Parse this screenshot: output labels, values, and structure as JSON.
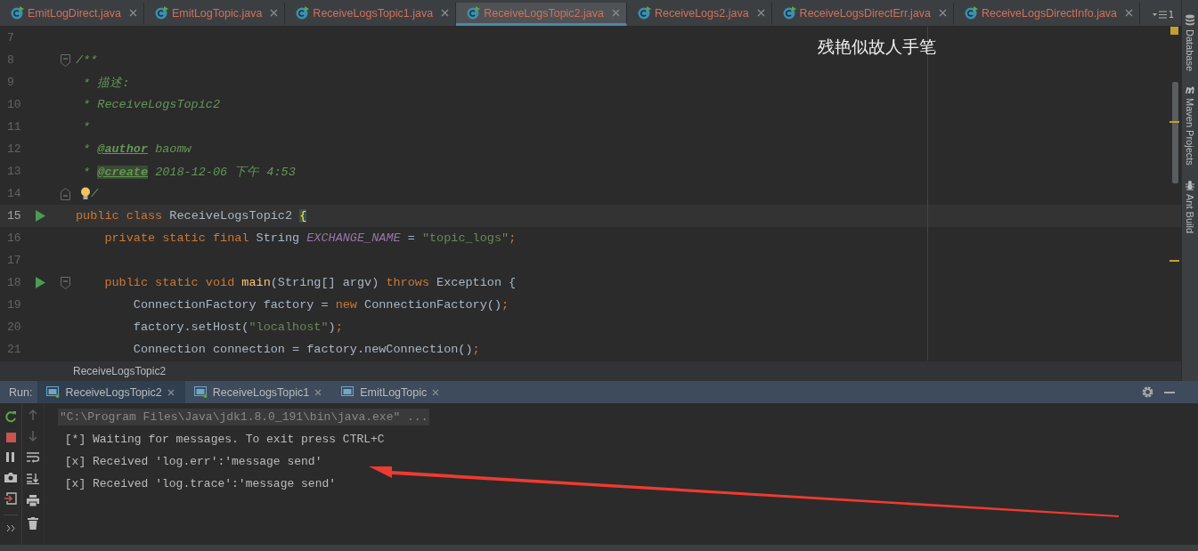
{
  "editor_tabs": [
    {
      "label": "EmitLogDirect.java",
      "selected": false
    },
    {
      "label": "EmitLogTopic.java",
      "selected": false
    },
    {
      "label": "ReceiveLogsTopic1.java",
      "selected": false
    },
    {
      "label": "ReceiveLogsTopic2.java",
      "selected": true
    },
    {
      "label": "ReceiveLogs2.java",
      "selected": false
    },
    {
      "label": "ReceiveLogsDirectErr.java",
      "selected": false
    },
    {
      "label": "ReceiveLogsDirectInfo.java",
      "selected": false
    }
  ],
  "tab_overflow_count": "1",
  "code_lines": [
    {
      "number": "7",
      "kind": "code",
      "run": false,
      "current": false
    },
    {
      "number": "8",
      "kind": "fold-start",
      "run": false,
      "current": false,
      "tokens": [
        {
          "kind": "comment",
          "text": "/**"
        }
      ]
    },
    {
      "number": "9",
      "run": false,
      "current": false,
      "tokens": [
        {
          "kind": "comment",
          "text": " * 描述:"
        }
      ]
    },
    {
      "number": "10",
      "run": false,
      "current": false,
      "tokens": [
        {
          "kind": "comment",
          "text": " * ReceiveLogsTopic2"
        }
      ]
    },
    {
      "number": "11",
      "run": false,
      "current": false,
      "tokens": [
        {
          "kind": "comment",
          "text": " *"
        }
      ]
    },
    {
      "number": "12",
      "run": false,
      "current": false,
      "tokens": [
        {
          "kind": "comment",
          "text": " * "
        },
        {
          "kind": "doctag",
          "text": "@author"
        },
        {
          "kind": "comment",
          "text": " baomw"
        }
      ]
    },
    {
      "number": "13",
      "run": false,
      "current": false,
      "tokens": [
        {
          "kind": "comment",
          "text": " * "
        },
        {
          "kind": "doctag-marked",
          "text": "@create"
        },
        {
          "kind": "comment",
          "text": " 2018-12-06 下午 4:53"
        }
      ]
    },
    {
      "number": "14",
      "kind": "fold-end",
      "run": false,
      "current": false,
      "bulb": true,
      "tokens": [
        {
          "kind": "comment",
          "text": "/"
        }
      ]
    },
    {
      "number": "15",
      "run": true,
      "current": true,
      "tokens": [
        {
          "kind": "keyword",
          "text": "public class "
        },
        {
          "kind": "plain",
          "text": "ReceiveLogsTopic2 "
        },
        {
          "kind": "brace",
          "text": "{"
        }
      ]
    },
    {
      "number": "16",
      "run": false,
      "current": false,
      "tokens": [
        {
          "kind": "keyword",
          "text": "    private static final "
        },
        {
          "kind": "plain",
          "text": "String "
        },
        {
          "kind": "constant",
          "text": "EXCHANGE_NAME"
        },
        {
          "kind": "plain",
          "text": " = "
        },
        {
          "kind": "string",
          "text": "\"topic_logs\""
        },
        {
          "kind": "keyword",
          "text": ";"
        }
      ]
    },
    {
      "number": "17",
      "kind": "code",
      "run": false,
      "current": false
    },
    {
      "number": "18",
      "kind": "fold-start",
      "run": true,
      "current": false,
      "tokens": [
        {
          "kind": "keyword",
          "text": "    public static void "
        },
        {
          "kind": "method",
          "text": "main"
        },
        {
          "kind": "plain",
          "text": "(String[] argv) "
        },
        {
          "kind": "keyword",
          "text": "throws "
        },
        {
          "kind": "plain",
          "text": "Exception {"
        }
      ]
    },
    {
      "number": "19",
      "run": false,
      "current": false,
      "tokens": [
        {
          "kind": "plain",
          "text": "        ConnectionFactory factory = "
        },
        {
          "kind": "keyword",
          "text": "new "
        },
        {
          "kind": "plain",
          "text": "ConnectionFactory()"
        },
        {
          "kind": "keyword",
          "text": ";"
        }
      ]
    },
    {
      "number": "20",
      "run": false,
      "current": false,
      "tokens": [
        {
          "kind": "plain",
          "text": "        factory.setHost("
        },
        {
          "kind": "string",
          "text": "\"localhost\""
        },
        {
          "kind": "plain",
          "text": ")"
        },
        {
          "kind": "keyword",
          "text": ";"
        }
      ]
    },
    {
      "number": "21",
      "run": false,
      "current": false,
      "tokens": [
        {
          "kind": "plain",
          "text": "        Connection connection = factory.newConnection()"
        },
        {
          "kind": "keyword",
          "text": ";"
        }
      ]
    }
  ],
  "overlay_caption": "残艳似故人手笔",
  "breadcrumb": "ReceiveLogsTopic2",
  "side_tools": [
    {
      "label": "Database",
      "kind": "database"
    },
    {
      "label": "Maven Projects",
      "kind": "maven"
    },
    {
      "label": "Ant Build",
      "kind": "ant"
    }
  ],
  "run_panel": {
    "label": "Run:",
    "tabs": [
      {
        "label": "ReceiveLogsTopic2",
        "selected": true,
        "running": true
      },
      {
        "label": "ReceiveLogsTopic1",
        "selected": false,
        "running": true
      },
      {
        "label": "EmitLogTopic",
        "selected": false,
        "running": false
      }
    ],
    "console": [
      {
        "kind": "command",
        "text": "\"C:\\Program Files\\Java\\jdk1.8.0_191\\bin\\java.exe\" ..."
      },
      {
        "kind": "output",
        "text": " [*] Waiting for messages. To exit press CTRL+C"
      },
      {
        "kind": "output",
        "text": " [x] Received 'log.err':'message send'"
      },
      {
        "kind": "output",
        "text": " [x] Received 'log.trace':'message send'"
      }
    ]
  }
}
